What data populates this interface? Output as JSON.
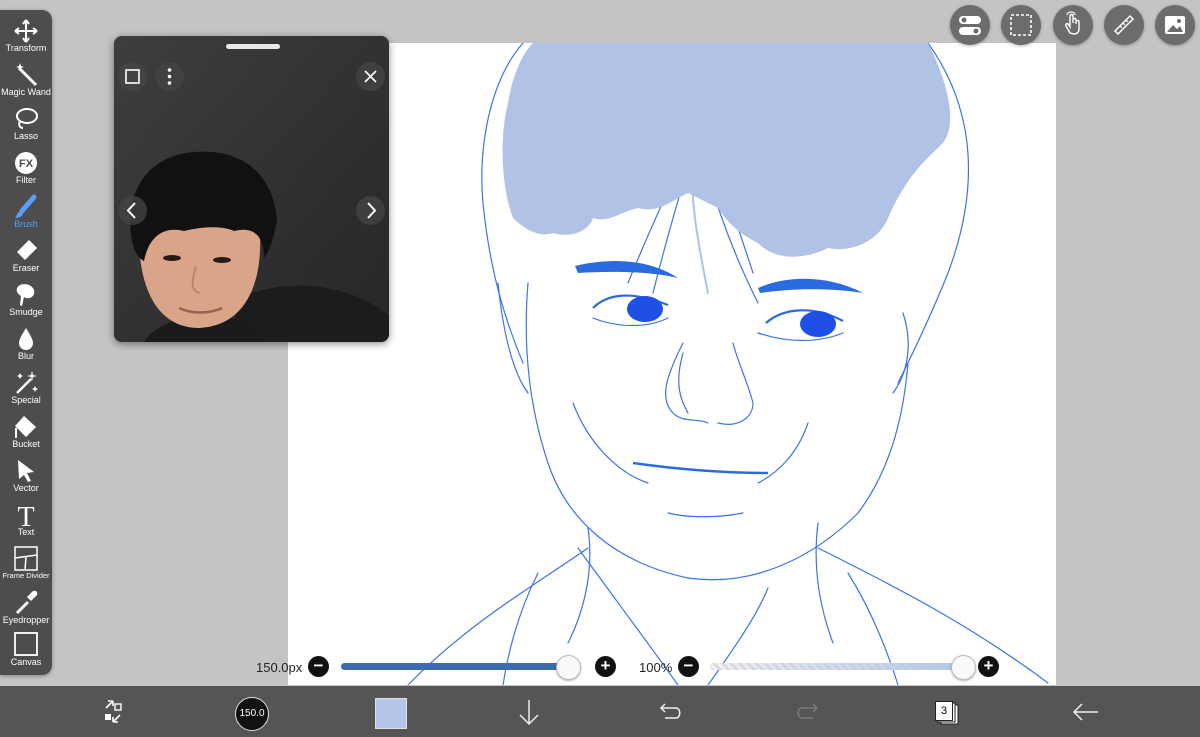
{
  "toolbar": {
    "tools": [
      {
        "label": "Transform",
        "icon": "transform-icon"
      },
      {
        "label": "Magic Wand",
        "icon": "magic-wand-icon"
      },
      {
        "label": "Lasso",
        "icon": "lasso-icon"
      },
      {
        "label": "Filter",
        "icon": "fx-icon",
        "glyph": "FX"
      },
      {
        "label": "Brush",
        "icon": "brush-icon",
        "active": true
      },
      {
        "label": "Eraser",
        "icon": "eraser-icon"
      },
      {
        "label": "Smudge",
        "icon": "smudge-icon"
      },
      {
        "label": "Blur",
        "icon": "blur-icon"
      },
      {
        "label": "Special",
        "icon": "special-icon"
      },
      {
        "label": "Bucket",
        "icon": "bucket-icon"
      },
      {
        "label": "Vector",
        "icon": "vector-icon"
      },
      {
        "label": "Text",
        "icon": "text-icon",
        "glyph": "T"
      },
      {
        "label": "Frame Divider",
        "icon": "frame-divider-icon"
      },
      {
        "label": "Eyedropper",
        "icon": "eyedropper-icon"
      },
      {
        "label": "Canvas",
        "icon": "canvas-icon"
      }
    ]
  },
  "brush_size": {
    "label": "150.0px",
    "value": 150.0,
    "fill_fraction": 0.94
  },
  "opacity": {
    "label": "100%",
    "value": 100
  },
  "brush_preview": {
    "label": "150.0"
  },
  "layers": {
    "count": "3"
  },
  "colors": {
    "accent": "#5b9dff",
    "current_color": "#b3c5e8",
    "hair_fill": "#b0c3e6",
    "line_color": "#2b6be0",
    "eye_color": "#1f4fe6",
    "slider_fill": "#3d6ab0"
  },
  "icons": {
    "reference_window": [
      "square-icon",
      "more-vertical-icon",
      "close-icon",
      "chevron-left-icon",
      "chevron-right-icon"
    ],
    "top_bar": [
      "toggle-settings-icon",
      "selection-icon",
      "hand-touch-icon",
      "ruler-icon",
      "image-icon"
    ],
    "bottom_bar": [
      "swap-colors-icon",
      "arrow-down-icon",
      "undo-icon",
      "redo-icon",
      "layers-icon",
      "back-arrow-icon"
    ]
  }
}
